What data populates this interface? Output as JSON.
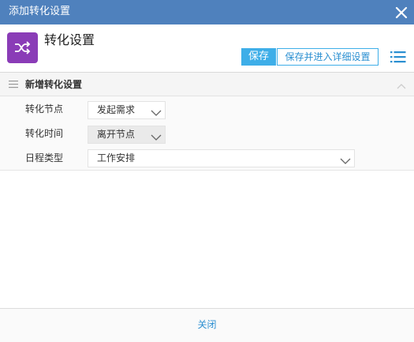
{
  "window": {
    "title": "添加转化设置",
    "close_icon": "close-icon"
  },
  "header": {
    "app_icon": "shuffle-icon",
    "app_icon_color": "#8a3cb7",
    "title": "转化设置",
    "save_label": "保存",
    "save_detail_label": "保存并进入详细设置",
    "menu_icon": "list-menu-icon",
    "accent_color": "#3eaee8"
  },
  "section": {
    "title": "新增转化设置",
    "collapse_icon": "chevron-up-icon"
  },
  "form": {
    "fields": [
      {
        "label": "转化节点",
        "value": "发起需求",
        "disabled": false
      },
      {
        "label": "转化时间",
        "value": "离开节点",
        "disabled": true
      },
      {
        "label": "日程类型",
        "value": "工作安排",
        "disabled": false
      }
    ]
  },
  "footer": {
    "close_label": "关闭"
  }
}
